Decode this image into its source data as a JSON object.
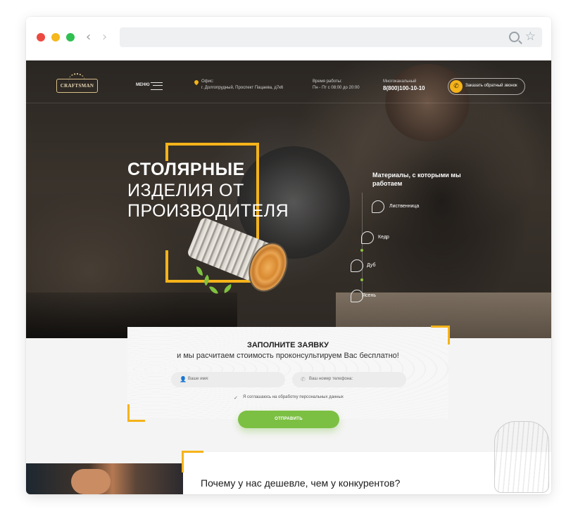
{
  "site": {
    "logo_text": "CRAFTSMAN",
    "menu_label": "Меню",
    "office_label": "Офис:",
    "office_address": "г. Долгопрудный, Проспект Пацаева, д7к6",
    "hours_label": "Время работы:",
    "hours_value": "Пн - Пт с 08:00 до 20:00",
    "phone_label": "Многоканальный",
    "phone_value": "8(800)100-10-10",
    "callback_button": "Заказать обратный звонок"
  },
  "hero": {
    "title_line1": "СТОЛЯРНЫЕ",
    "title_line2": "ИЗДЕЛИЯ ОТ",
    "title_line3": "ПРОИЗВОДИТЕЛЯ",
    "materials_title": "Материалы, с которыми мы работаем",
    "materials": [
      {
        "label": "Лиственница",
        "icon": "larch-leaf-icon"
      },
      {
        "label": "Кедр",
        "icon": "cedar-cone-icon"
      },
      {
        "label": "Дуб",
        "icon": "oak-leaf-icon"
      },
      {
        "label": "Ясень",
        "icon": "ash-leaf-icon"
      }
    ]
  },
  "form": {
    "title": "ЗАПОЛНИТЕ ЗАЯВКУ",
    "subtitle": "и мы расчитаем стоимость проконсультируем Вас бесплатно!",
    "name_placeholder": "Ваше имя:",
    "phone_placeholder": "Ваш номер телефона:",
    "agreement": "Я соглашаюсь на обработку персональных данных",
    "submit": "ОТПРАВИТЬ"
  },
  "section2": {
    "heading": "Почему у нас дешевле, чем у конкурентов?"
  },
  "colors": {
    "accent_yellow": "#f5b31a",
    "accent_green": "#7cc043"
  }
}
